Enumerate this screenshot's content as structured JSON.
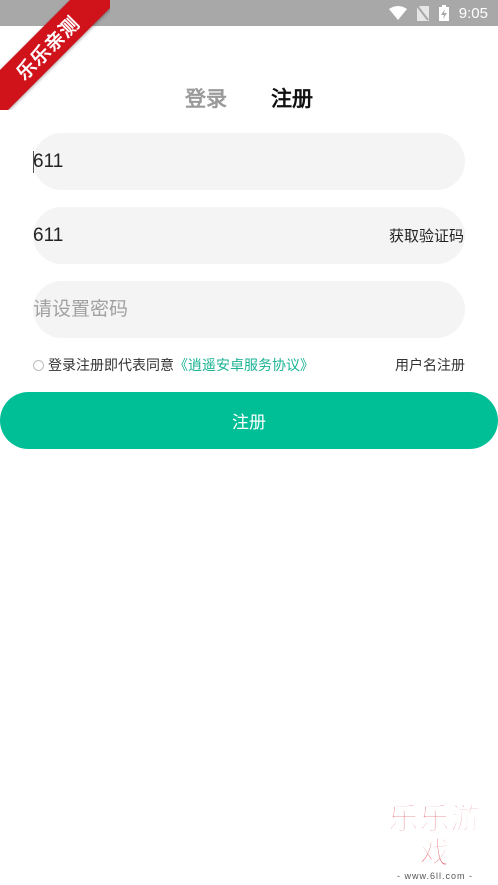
{
  "status_bar": {
    "time": "9:05",
    "icons": [
      "wifi-icon",
      "no-sim-icon",
      "battery-charging-icon"
    ]
  },
  "ribbon": {
    "text": "乐乐亲测"
  },
  "tabs": [
    {
      "label": "登录",
      "active": false
    },
    {
      "label": "注册",
      "active": true
    }
  ],
  "form": {
    "phone": {
      "value": "611",
      "placeholder": ""
    },
    "code": {
      "value": "611",
      "placeholder": "",
      "get_code_label": "获取验证码"
    },
    "password": {
      "value": "",
      "placeholder": "请设置密码"
    }
  },
  "agreement": {
    "prefix": "登录注册即代表同意",
    "link": "《逍遥安卓服务协议》",
    "username_register": "用户名注册"
  },
  "submit_label": "注册",
  "watermark": {
    "title": "乐乐游戏",
    "sub": "- www.6ll.com -"
  },
  "colors": {
    "accent": "#00bf97",
    "link": "#1ab394",
    "ribbon": "#d0121b",
    "status_bar": "#a8a8a8"
  }
}
